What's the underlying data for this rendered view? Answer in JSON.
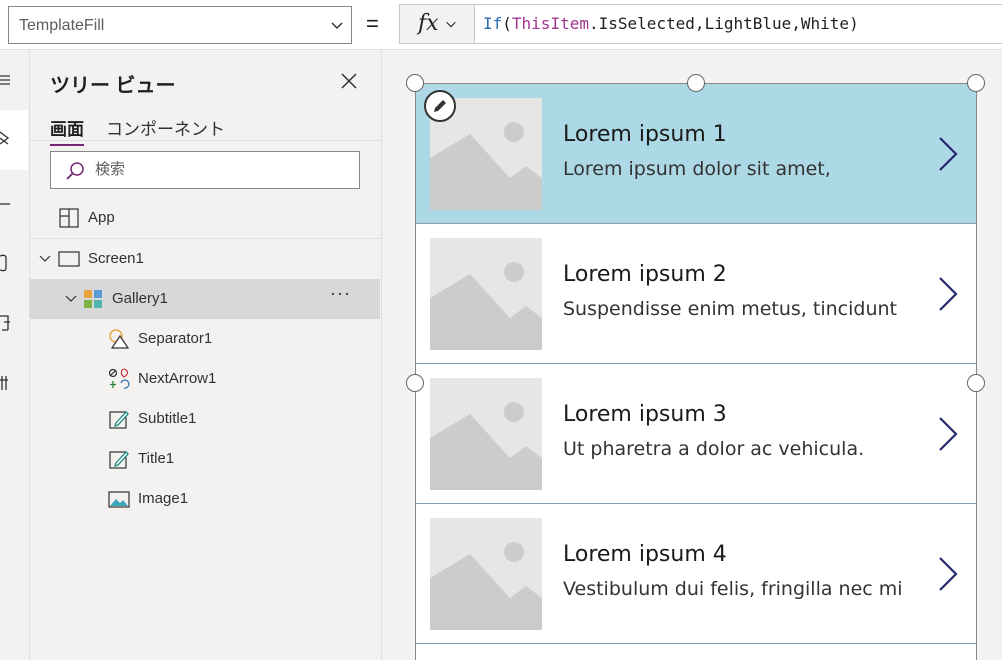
{
  "formula_bar": {
    "property": "TemplateFill",
    "equals": "=",
    "fx": "fx",
    "formula": {
      "fn": "If",
      "open": "(",
      "arg1_obj": "ThisItem",
      "arg1_prop": ".IsSelected,LightBlue,White",
      "close": ")"
    }
  },
  "rail": {
    "items": [
      "menu-icon",
      "tree-view-icon",
      "insert-icon",
      "data-icon",
      "media-icon",
      "advanced-tools-icon"
    ]
  },
  "tree": {
    "title": "ツリー ビュー",
    "tabs": [
      "画面",
      "コンポーネント"
    ],
    "search_placeholder": "検索",
    "nodes": {
      "app": "App",
      "screen1": "Screen1",
      "gallery1": "Gallery1",
      "separator1": "Separator1",
      "nextarrow1": "NextArrow1",
      "subtitle1": "Subtitle1",
      "title1": "Title1",
      "image1": "Image1"
    },
    "more": "···"
  },
  "gallery": {
    "template_fill_selected": "#add8e6",
    "template_fill": "#ffffff",
    "items": [
      {
        "title": "Lorem ipsum 1",
        "subtitle": "Lorem ipsum dolor sit amet,",
        "selected": true
      },
      {
        "title": "Lorem ipsum 2",
        "subtitle": "Suspendisse enim metus, tincidunt",
        "selected": false
      },
      {
        "title": "Lorem ipsum 3",
        "subtitle": "Ut pharetra a dolor ac vehicula.",
        "selected": false
      },
      {
        "title": "Lorem ipsum 4",
        "subtitle": "Vestibulum dui felis, fringilla nec mi",
        "selected": false
      }
    ]
  },
  "colors": {
    "accent": "#742774",
    "arrow": "#1f2a6b",
    "placeholder_image": "#cccccc"
  }
}
